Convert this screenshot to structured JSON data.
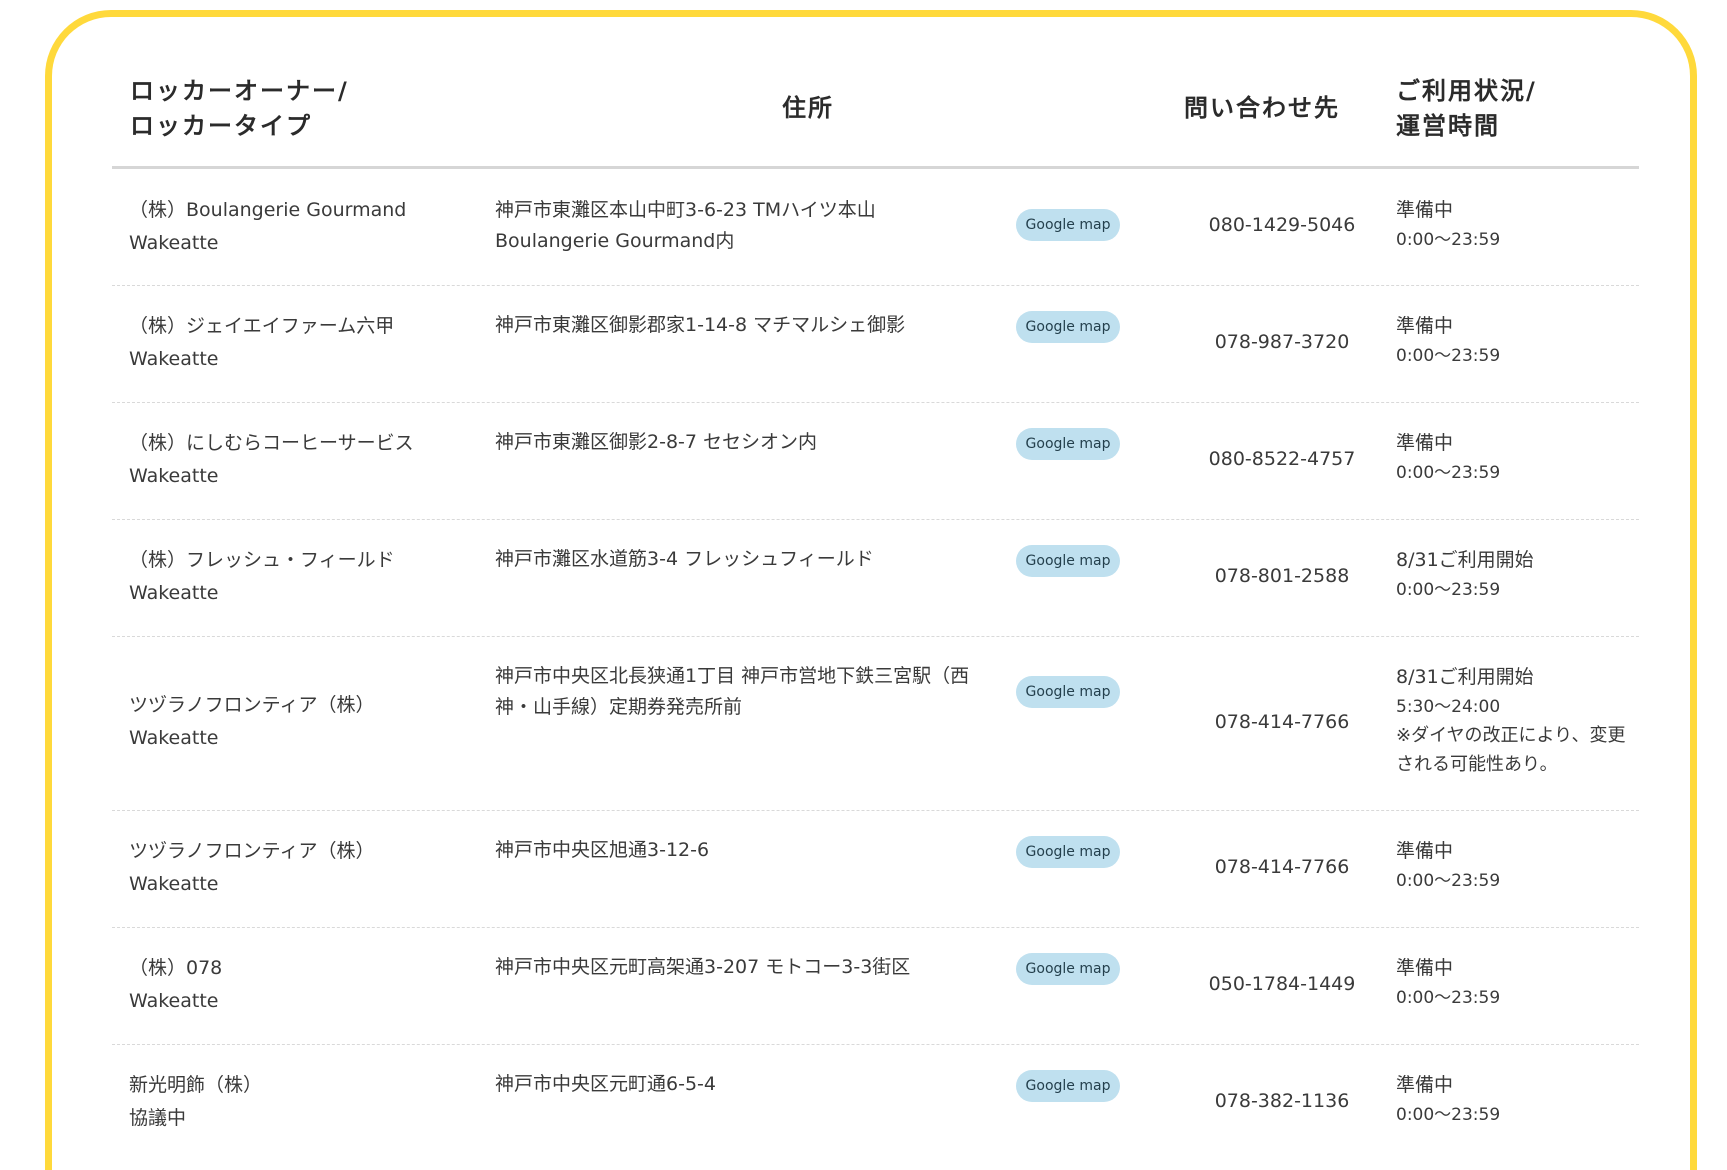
{
  "header": {
    "owner_line1": "ロッカーオーナー/",
    "owner_line2": "ロッカータイプ",
    "address": "住所",
    "contact": "問い合わせ先",
    "status_line1": "ご利用状況/",
    "status_line2": "運営時間"
  },
  "map_label": "Google map",
  "rows": [
    {
      "owner": "（株）Boulangerie Gourmand",
      "type": "Wakeatte",
      "address": "神戸市東灘区本山中町3-6-23 TMハイツ本山 Boulangerie Gourmand内",
      "tel": "080-1429-5046",
      "status": "準備中",
      "hours": "0:00〜23:59",
      "note": ""
    },
    {
      "owner": "（株）ジェイエイファーム六甲",
      "type": "Wakeatte",
      "address": "神戸市東灘区御影郡家1-14-8 マチマルシェ御影",
      "tel": "078-987-3720",
      "status": "準備中",
      "hours": "0:00〜23:59",
      "note": ""
    },
    {
      "owner": "（株）にしむらコーヒーサービス",
      "type": "Wakeatte",
      "address": "神戸市東灘区御影2-8-7 セセシオン内",
      "tel": "080-8522-4757",
      "status": "準備中",
      "hours": "0:00〜23:59",
      "note": ""
    },
    {
      "owner": "（株）フレッシュ・フィールド",
      "type": "Wakeatte",
      "address": "神戸市灘区水道筋3-4 フレッシュフィールド",
      "tel": "078-801-2588",
      "status": "8/31ご利用開始",
      "hours": "0:00〜23:59",
      "note": ""
    },
    {
      "owner": "ツヅラノフロンティア（株）",
      "type": "Wakeatte",
      "address": "神戸市中央区北長狭通1丁目 神戸市営地下鉄三宮駅（西神・山手線）定期券発売所前",
      "tel": "078-414-7766",
      "status": "8/31ご利用開始",
      "hours": "5:30〜24:00",
      "note": "※ダイヤの改正により、変更される可能性あり。"
    },
    {
      "owner": "ツヅラノフロンティア（株）",
      "type": "Wakeatte",
      "address": "神戸市中央区旭通3-12-6",
      "tel": "078-414-7766",
      "status": "準備中",
      "hours": "0:00〜23:59",
      "note": ""
    },
    {
      "owner": "（株）078",
      "type": "Wakeatte",
      "address": "神戸市中央区元町高架通3-207 モトコー3-3街区",
      "tel": "050-1784-1449",
      "status": "準備中",
      "hours": "0:00〜23:59",
      "note": ""
    },
    {
      "owner": "新光明飾（株）",
      "type": "協議中",
      "address": "神戸市中央区元町通6-5-4",
      "tel": "078-382-1136",
      "status": "準備中",
      "hours": "0:00〜23:59",
      "note": ""
    }
  ]
}
